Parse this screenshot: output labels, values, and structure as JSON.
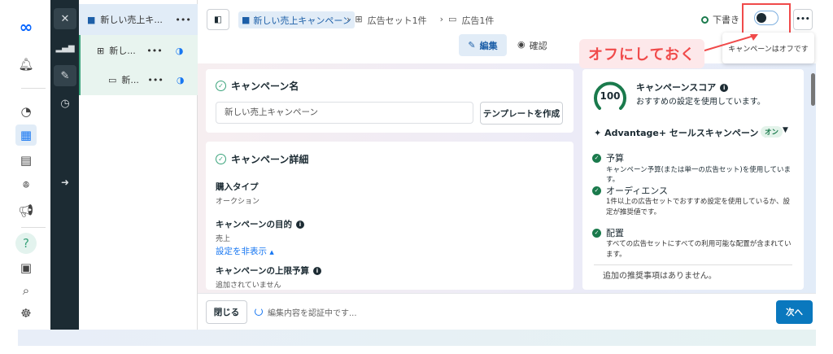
{
  "rail": {
    "icons": [
      "meta-logo",
      "bell-icon",
      "gauge-icon",
      "table-icon",
      "pages-icon",
      "audience-icon",
      "megaphone-icon",
      "help-icon",
      "news-icon",
      "search-icon",
      "bug-icon"
    ]
  },
  "tree": {
    "items": [
      {
        "label": "新しい売上キ..."
      },
      {
        "label": "新し..."
      },
      {
        "label": "新..."
      }
    ]
  },
  "breadcrumb": {
    "campaign": "新しい売上キャンペーン",
    "adset": "広告セット1件",
    "ad": "広告1件"
  },
  "status": {
    "label": "下書き",
    "toggle_on": false,
    "tooltip": "キャンペーンはオフです"
  },
  "tabs": {
    "edit": "編集",
    "review": "確認"
  },
  "annotation": {
    "text": "オフにしておく",
    "color": "#f04a4a"
  },
  "name_card": {
    "title": "キャンペーン名",
    "input_value": "新しい売上キャンペーン",
    "template_button": "テンプレートを作成"
  },
  "details": {
    "title": "キャンペーン詳細",
    "fields": [
      {
        "label": "購入タイプ",
        "value": "オークション"
      },
      {
        "label": "キャンペーンの目的",
        "value": "売上"
      }
    ],
    "hide_link": "設定を非表示",
    "budget_label": "キャンペーンの上限予算",
    "budget_value": "追加されていません"
  },
  "score": {
    "value": "100",
    "title": "キャンペーンスコア",
    "subtitle": "おすすめの設定を使用しています。",
    "advantage": "Advantage+ セールスキャンペーン",
    "advantage_badge": "オン",
    "items": [
      {
        "title": "予算",
        "desc": "キャンペーン予算(または単一の広告セット)を使用しています。"
      },
      {
        "title": "オーディエンス",
        "desc": "1件以上の広告セットでおすすめ設定を使用しているか、設定が推奨値です。"
      },
      {
        "title": "配置",
        "desc": "すべての広告セットにすべての利用可能な配置が含まれています。"
      }
    ],
    "more": "追加の推奨事項はありません。"
  },
  "footer": {
    "close": "閉じる",
    "status": "編集内容を認証中です...",
    "next": "次へ"
  },
  "colors": {
    "accent": "#1877f2",
    "primary_button": "#0a78be",
    "dark_sidebar": "#1c2b33",
    "success": "#1a7a4c"
  }
}
